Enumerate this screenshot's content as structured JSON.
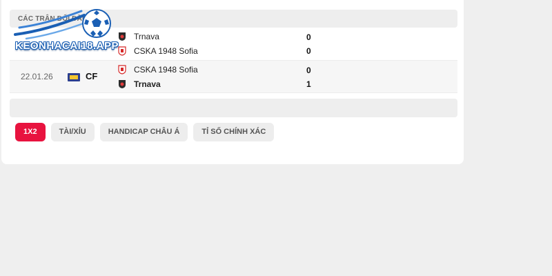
{
  "section": {
    "title": "CÁC TRẬN ĐỐI ĐẦU"
  },
  "logo": {
    "text": "KEONHACAI18.APP"
  },
  "matches": [
    {
      "date": "",
      "competition": "",
      "home": {
        "name": "Trnava",
        "score": "0"
      },
      "away": {
        "name": "CSKA 1948 Sofia",
        "score": "0"
      }
    },
    {
      "date": "22.01.26",
      "competition": "CF",
      "home": {
        "name": "CSKA 1948 Sofia",
        "score": "0"
      },
      "away": {
        "name": "Trnava",
        "score": "1"
      }
    }
  ],
  "tabs": [
    "1X2",
    "TÀI/XỈU",
    "HANDICAP CHÂU Á",
    "TỈ SỐ CHÍNH XÁC"
  ],
  "colors": {
    "accent": "#e8133f",
    "trnava_crest": "#2b2b2b",
    "cska_crest": "#d62828"
  }
}
